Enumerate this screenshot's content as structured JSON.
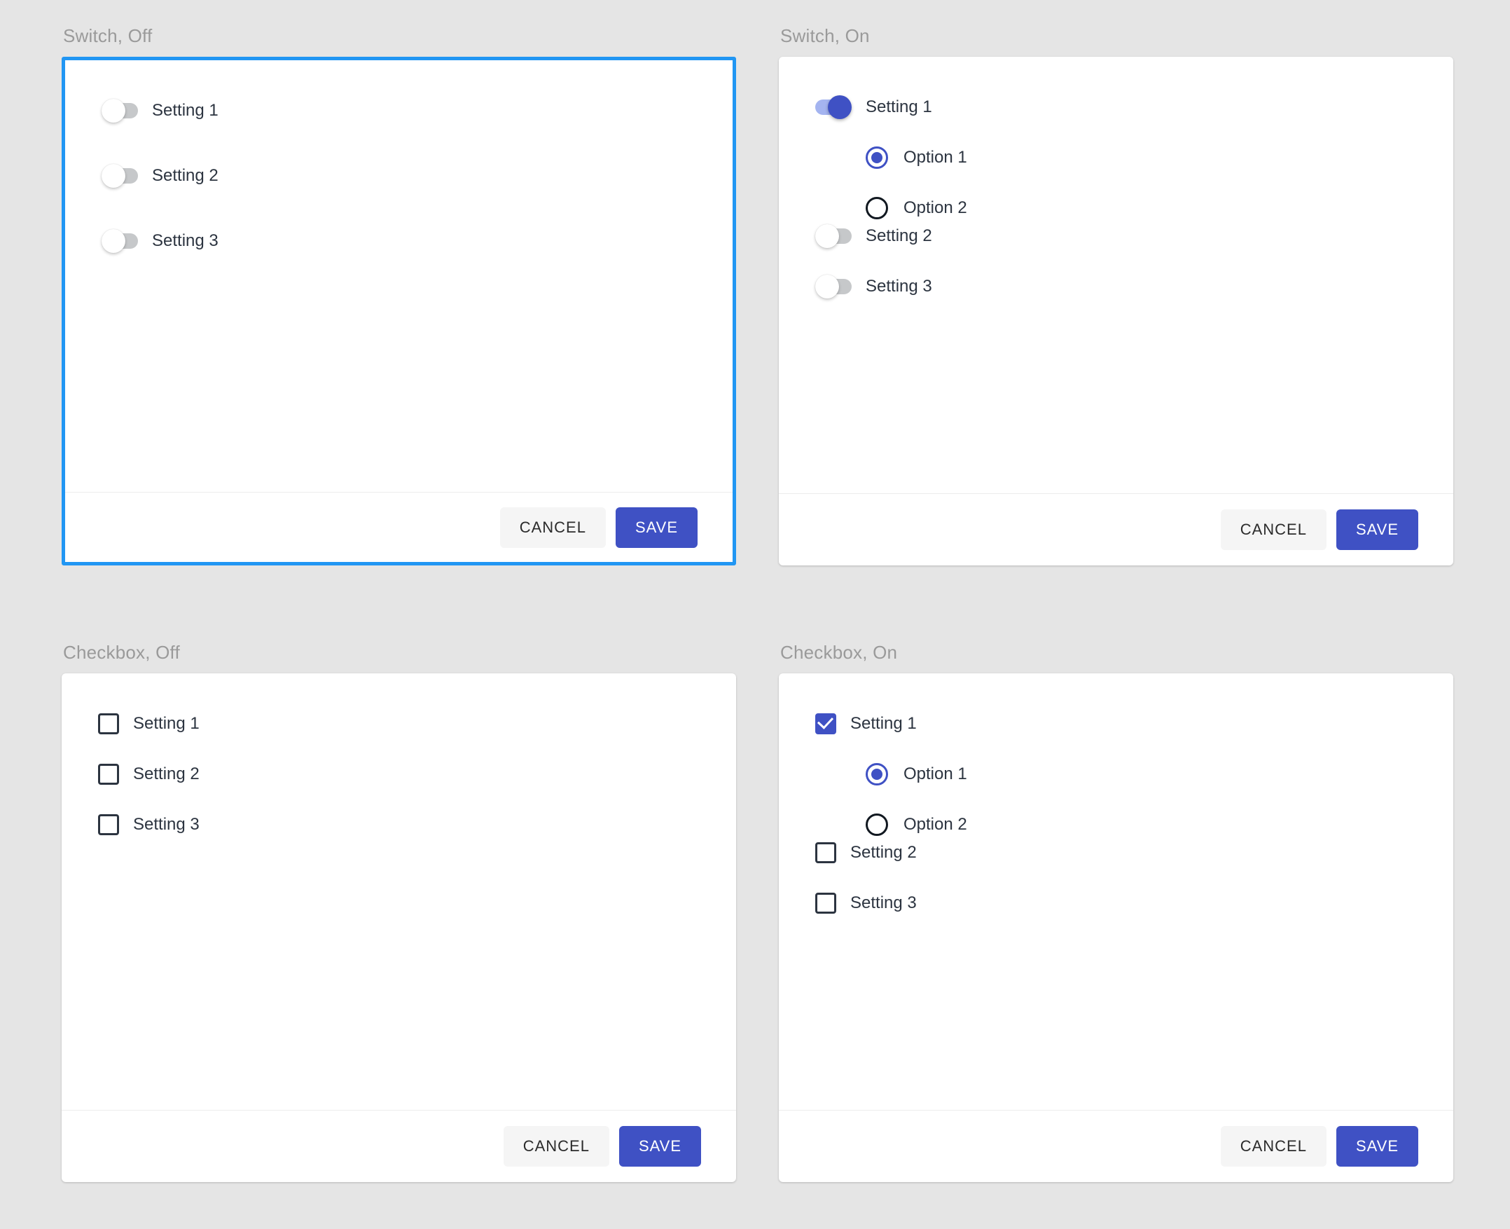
{
  "theme": {
    "page_background": "#e5e5e5",
    "card_background": "#ffffff",
    "accent_indigo": "#3f51c4",
    "focus_blue": "#2196f3",
    "switch_off_track": "#c6c8ca",
    "switch_on_track": "#a4b4f0",
    "caption_color": "#9a9a9a",
    "label_color": "#2c3440",
    "cancel_background": "#f5f5f5"
  },
  "panels": [
    {
      "id": "switch-off",
      "caption": "Switch, Off",
      "focused": true,
      "control_type": "switch",
      "rows": [
        {
          "label": "Setting 1",
          "state": "off"
        },
        {
          "label": "Setting 2",
          "state": "off"
        },
        {
          "label": "Setting 3",
          "state": "off"
        }
      ],
      "footer": {
        "cancel_label": "CANCEL",
        "save_label": "SAVE"
      }
    },
    {
      "id": "switch-on",
      "caption": "Switch, On",
      "focused": false,
      "control_type": "switch",
      "rows": [
        {
          "label": "Setting 1",
          "state": "on"
        },
        {
          "label": "Setting 2",
          "state": "off"
        },
        {
          "label": "Setting 3",
          "state": "off"
        }
      ],
      "options": [
        {
          "label": "Option 1",
          "selected": true
        },
        {
          "label": "Option 2",
          "selected": false
        }
      ],
      "footer": {
        "cancel_label": "CANCEL",
        "save_label": "SAVE"
      }
    },
    {
      "id": "checkbox-off",
      "caption": "Checkbox, Off",
      "focused": false,
      "control_type": "checkbox",
      "rows": [
        {
          "label": "Setting 1",
          "state": "off"
        },
        {
          "label": "Setting 2",
          "state": "off"
        },
        {
          "label": "Setting 3",
          "state": "off"
        }
      ],
      "footer": {
        "cancel_label": "CANCEL",
        "save_label": "SAVE"
      }
    },
    {
      "id": "checkbox-on",
      "caption": "Checkbox, On",
      "focused": false,
      "control_type": "checkbox",
      "rows": [
        {
          "label": "Setting 1",
          "state": "on"
        },
        {
          "label": "Setting 2",
          "state": "off"
        },
        {
          "label": "Setting 3",
          "state": "off"
        }
      ],
      "options": [
        {
          "label": "Option 1",
          "selected": true
        },
        {
          "label": "Option 2",
          "selected": false
        }
      ],
      "footer": {
        "cancel_label": "CANCEL",
        "save_label": "SAVE"
      }
    }
  ]
}
